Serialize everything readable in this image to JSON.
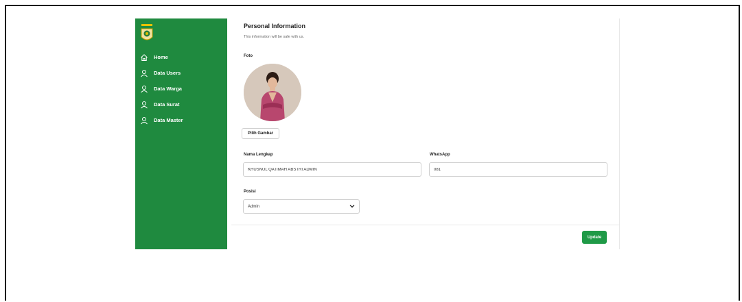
{
  "sidebar": {
    "items": [
      {
        "label": "Home",
        "icon": "home-icon"
      },
      {
        "label": "Data Users",
        "icon": "user-icon"
      },
      {
        "label": "Data Warga",
        "icon": "user-icon"
      },
      {
        "label": "Data Surat",
        "icon": "user-icon"
      },
      {
        "label": "Data Master",
        "icon": "user-icon"
      }
    ]
  },
  "main": {
    "title": "Personal Information",
    "subtitle": "This information will be safe with us.",
    "foto_label": "Foto",
    "pilih_gambar": "Pilih Gambar",
    "nama_label": "Nama Lengkap",
    "nama_value": "KHUSNUL QATIMAH ABSTRI ADMIN",
    "whatsapp_label": "WhatsApp",
    "whatsapp_value": "081",
    "posisi_label": "Posisi",
    "posisi_value": "Admin",
    "update_label": "Update"
  },
  "colors": {
    "sidebar": "#1f8a3f",
    "accent": "#1f9a47"
  }
}
